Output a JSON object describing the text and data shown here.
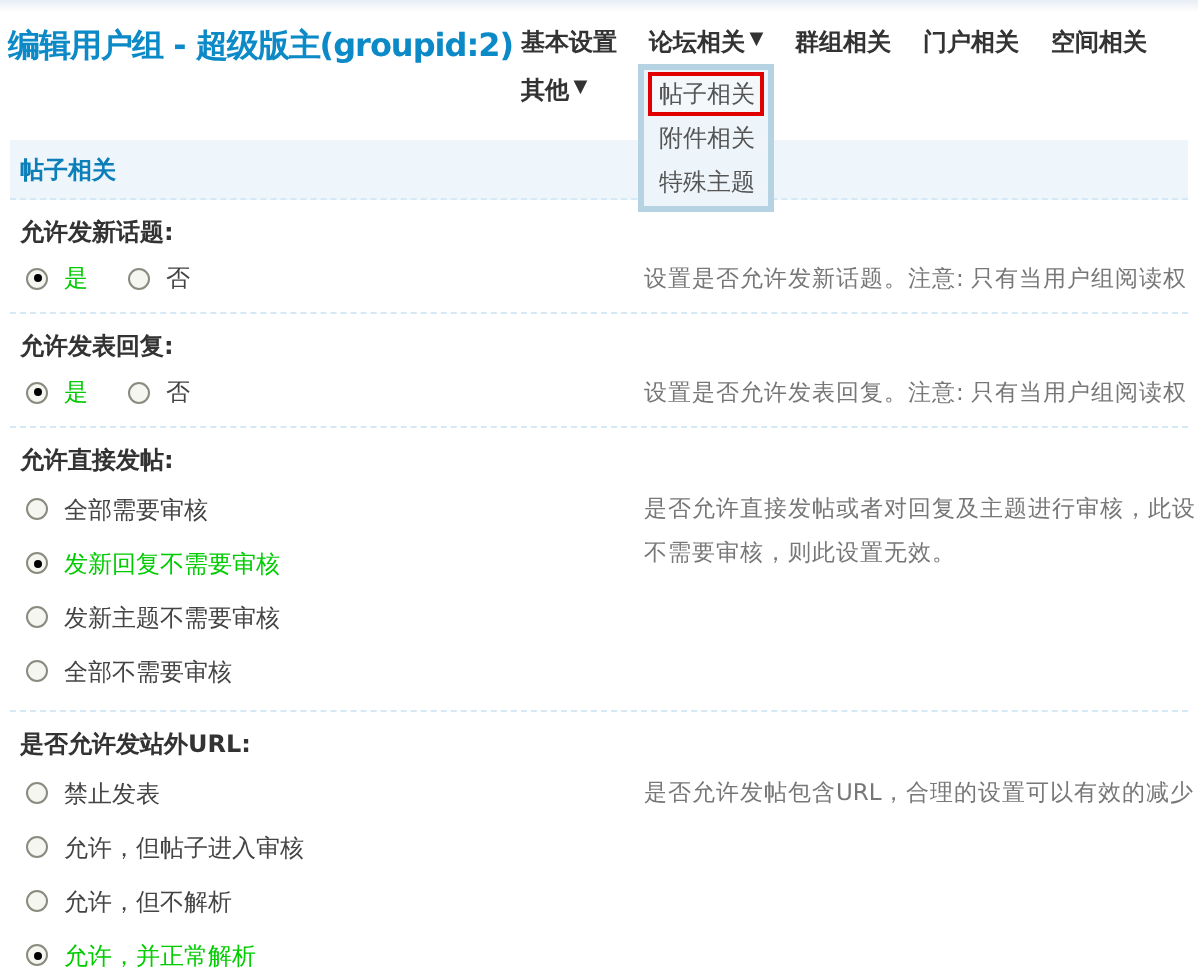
{
  "title": "编辑用户组 - 超级版主(groupid:2)",
  "nav": [
    {
      "label": "基本设置"
    },
    {
      "label": "论坛相关",
      "caret": "▼",
      "expanded": true,
      "menu": [
        {
          "label": "帖子相关",
          "selected": true
        },
        {
          "label": "附件相关",
          "selected": false
        },
        {
          "label": "特殊主题",
          "selected": false
        }
      ]
    },
    {
      "label": "群组相关"
    },
    {
      "label": "门户相关"
    },
    {
      "label": "空间相关"
    },
    {
      "label": "其他",
      "caret": "▼"
    }
  ],
  "section": {
    "title": "帖子相关"
  },
  "settings": [
    {
      "label": "允许发新话题:",
      "kind": "inline",
      "description": "设置是否允许发新话题。注意: 只有当用户组阅读权",
      "options": [
        {
          "label": "是",
          "selected": true
        },
        {
          "label": "否",
          "selected": false
        }
      ]
    },
    {
      "label": "允许发表回复:",
      "kind": "inline",
      "description": "设置是否允许发表回复。注意: 只有当用户组阅读权",
      "options": [
        {
          "label": "是",
          "selected": true
        },
        {
          "label": "否",
          "selected": false
        }
      ]
    },
    {
      "label": "允许直接发帖:",
      "kind": "list",
      "description": [
        "是否允许直接发帖或者对回复及主题进行审核，此设",
        "不需要审核，则此设置无效。"
      ],
      "options": [
        {
          "label": "全部需要审核",
          "selected": false
        },
        {
          "label": "发新回复不需要审核",
          "selected": true
        },
        {
          "label": "发新主题不需要审核",
          "selected": false
        },
        {
          "label": "全部不需要审核",
          "selected": false
        }
      ]
    },
    {
      "label": "是否允许发站外URL:",
      "kind": "list",
      "description": "是否允许发帖包含URL，合理的设置可以有效的减少",
      "options": [
        {
          "label": "禁止发表",
          "selected": false
        },
        {
          "label": "允许，但帖子进入审核",
          "selected": false
        },
        {
          "label": "允许，但不解析",
          "selected": false
        },
        {
          "label": "允许，并正常解析",
          "selected": true
        }
      ]
    }
  ]
}
